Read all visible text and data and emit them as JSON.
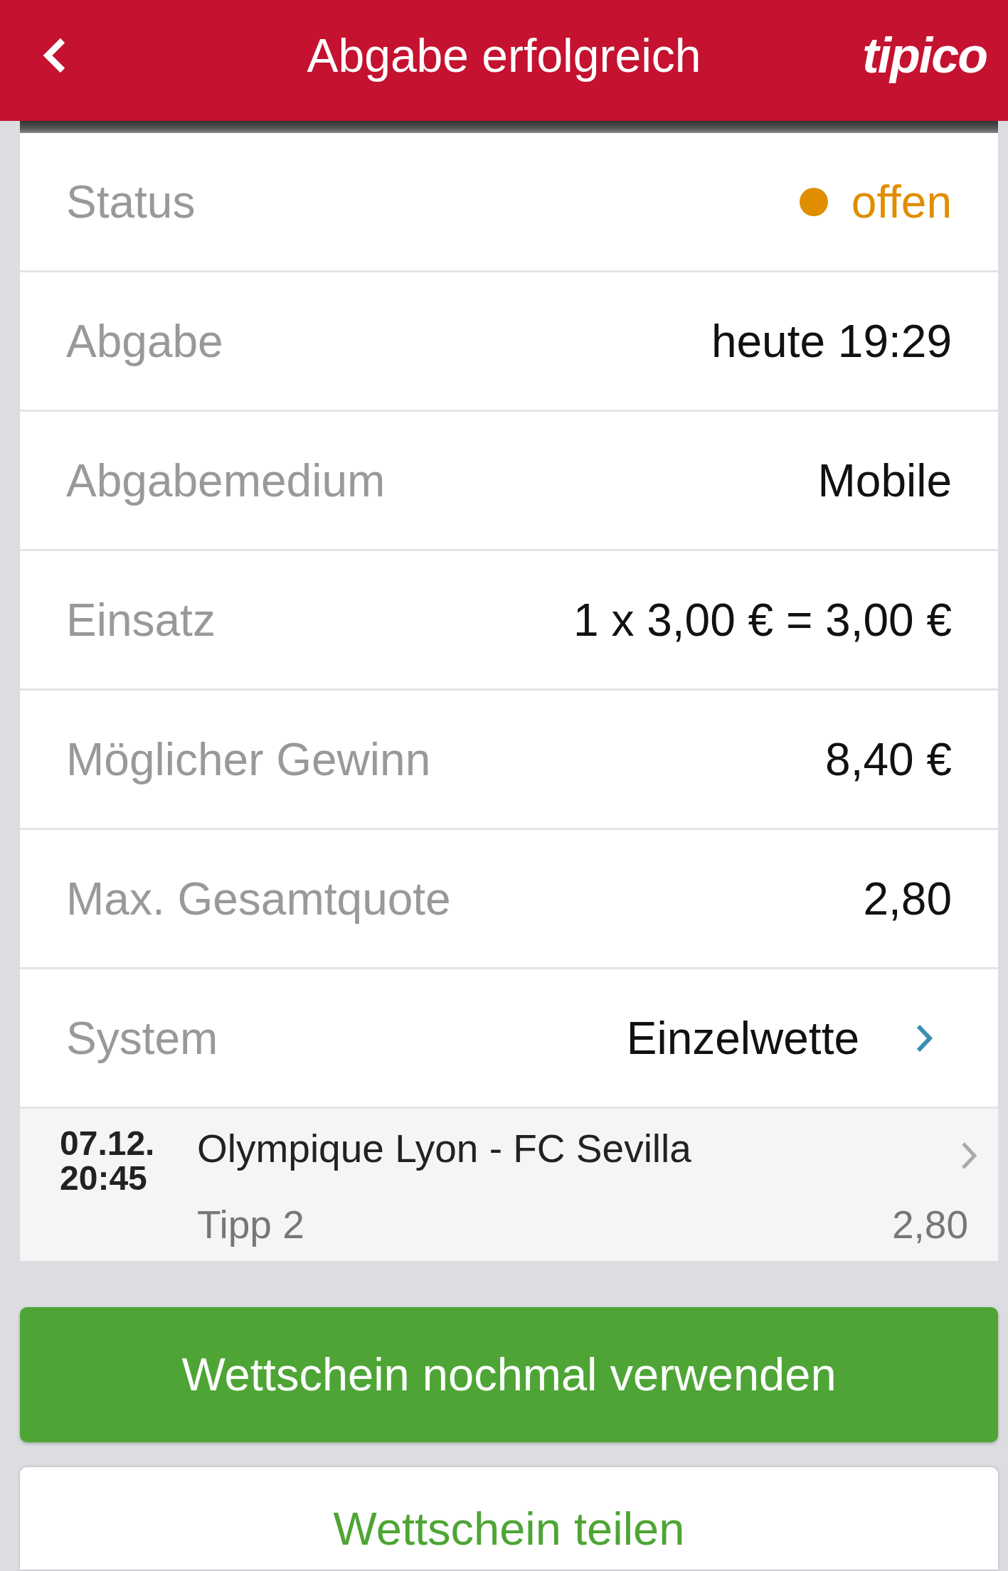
{
  "header": {
    "title": "Abgabe erfolgreich",
    "logo": "tipico"
  },
  "details": [
    {
      "kind": "status",
      "label": "Status",
      "value": "offen",
      "color": "#e08e00"
    },
    {
      "kind": "text",
      "label": "Abgabe",
      "value": "heute 19:29"
    },
    {
      "kind": "text",
      "label": "Abgabemedium",
      "value": "Mobile"
    },
    {
      "kind": "text",
      "label": "Einsatz",
      "value": "1 x 3,00 € = 3,00 €"
    },
    {
      "kind": "text",
      "label": "Möglicher Gewinn",
      "value": "8,40 €"
    },
    {
      "kind": "text",
      "label": "Max. Gesamtquote",
      "value": "2,80"
    },
    {
      "kind": "link",
      "label": "System",
      "value": "Einzelwette"
    }
  ],
  "bets": [
    {
      "date": "07.12.",
      "time": "20:45",
      "match": "Olympique Lyon - FC Sevilla",
      "tip": "Tipp 2",
      "odds": "2,80"
    }
  ],
  "buttons": [
    {
      "kind": "primary",
      "label": "Wettschein nochmal verwenden"
    },
    {
      "kind": "secondary",
      "label": "Wettschein teilen"
    }
  ]
}
